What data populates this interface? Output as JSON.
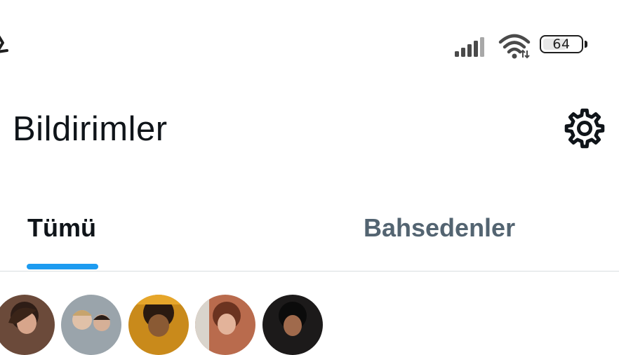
{
  "status_bar": {
    "battery_level": "64",
    "battery_fraction": 0.64,
    "icons": [
      "back-icon",
      "signal-icon",
      "wifi-icon",
      "battery-icon"
    ]
  },
  "header": {
    "title": "Bildirimler",
    "settings_icon": "gear-icon"
  },
  "tabs": [
    {
      "label": "Tümü",
      "active": true
    },
    {
      "label": "Bahsedenler",
      "active": false
    }
  ],
  "colors": {
    "accent": "#1d9bf0",
    "text_primary": "#0f1419",
    "text_secondary": "#536471",
    "divider": "#d9dde0"
  },
  "avatars": [
    "avatar-1",
    "avatar-2",
    "avatar-3",
    "avatar-4",
    "avatar-5"
  ]
}
